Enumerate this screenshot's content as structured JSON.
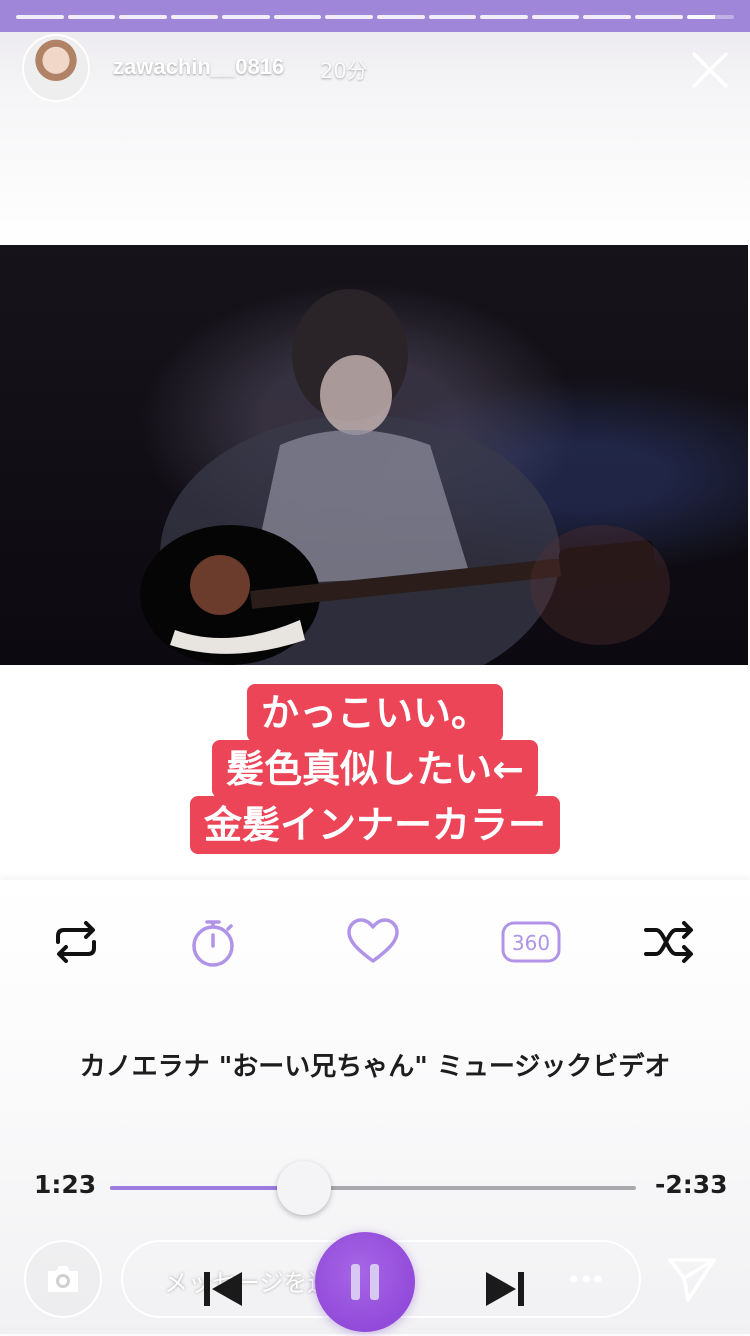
{
  "story": {
    "username": "zawachin__0816",
    "time_ago": "20分",
    "segments_total": 14,
    "segments_complete": 13,
    "current_segment_progress": 0.6
  },
  "caption": {
    "lines": [
      "かっこいい。",
      "髪色真似したい←",
      "金髪インナーカラー"
    ]
  },
  "player": {
    "controls": [
      {
        "name": "repeat-icon"
      },
      {
        "name": "timer-icon"
      },
      {
        "name": "heart-icon"
      },
      {
        "name": "360-icon",
        "label": "360"
      },
      {
        "name": "shuffle-icon"
      }
    ],
    "song_title": "カノエラナ \"おーい兄ちゃん\" ミュージックビデオ",
    "elapsed": "1:23",
    "remaining": "-2:33",
    "progress": 0.368
  },
  "bottom": {
    "message_placeholder": "メッセージを送信"
  },
  "colors": {
    "accent": "#9b7be0",
    "caption_bg": "#ec4558",
    "play_button": "#9a4fdc"
  }
}
